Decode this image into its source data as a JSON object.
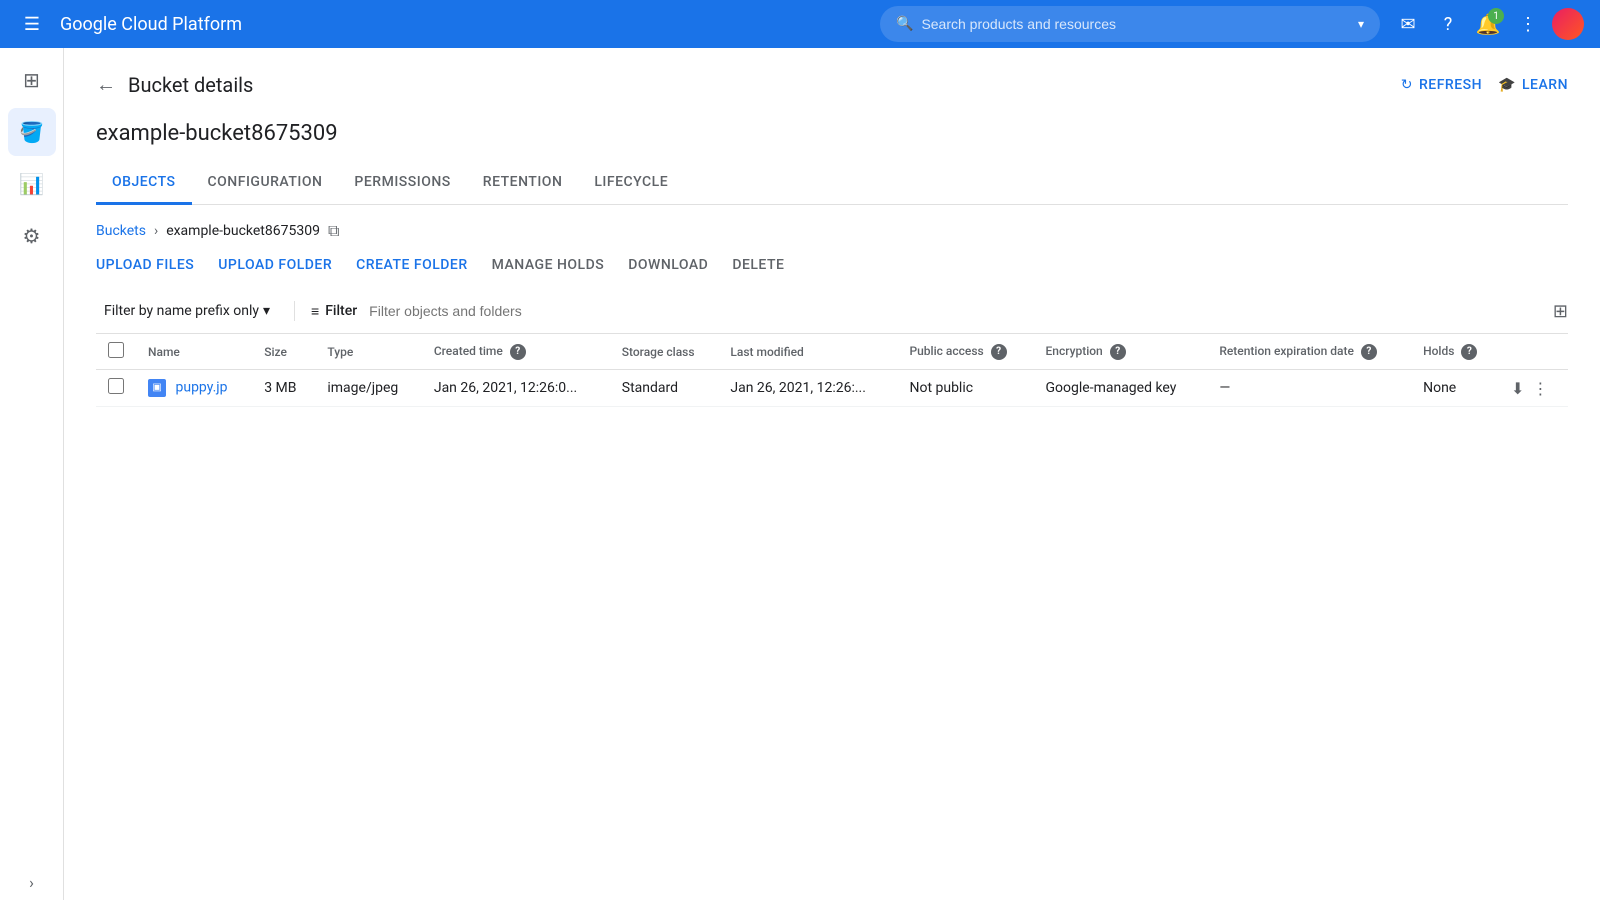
{
  "topnav": {
    "menu_icon": "☰",
    "title": "Google Cloud Platform",
    "search_placeholder": "Search products and resources",
    "dropdown_arrow": "▾",
    "notification_icon": "✉",
    "help_icon": "?",
    "badge_count": "1",
    "more_icon": "⋮"
  },
  "sidebar": {
    "icons": [
      {
        "name": "menu-grid-icon",
        "symbol": "⊞",
        "active": false
      },
      {
        "name": "storage-icon",
        "symbol": "🪣",
        "active": true
      },
      {
        "name": "chart-icon",
        "symbol": "📊",
        "active": false
      },
      {
        "name": "settings-icon",
        "symbol": "⚙",
        "active": false
      }
    ],
    "expand_label": "›"
  },
  "page": {
    "back_icon": "←",
    "title": "Bucket details",
    "refresh_label": "REFRESH",
    "refresh_icon": "↻",
    "learn_label": "LEARN",
    "learn_icon": "🎓",
    "bucket_name": "example-bucket8675309"
  },
  "tabs": [
    {
      "id": "objects",
      "label": "OBJECTS",
      "active": true
    },
    {
      "id": "configuration",
      "label": "CONFIGURATION",
      "active": false
    },
    {
      "id": "permissions",
      "label": "PERMISSIONS",
      "active": false
    },
    {
      "id": "retention",
      "label": "RETENTION",
      "active": false
    },
    {
      "id": "lifecycle",
      "label": "LIFECYCLE",
      "active": false
    }
  ],
  "breadcrumb": {
    "buckets_label": "Buckets",
    "separator": "›",
    "current": "example-bucket8675309",
    "copy_icon": "⧉"
  },
  "actions": [
    {
      "id": "upload-files",
      "label": "UPLOAD FILES",
      "disabled": false
    },
    {
      "id": "upload-folder",
      "label": "UPLOAD FOLDER",
      "disabled": false
    },
    {
      "id": "create-folder",
      "label": "CREATE FOLDER",
      "disabled": false
    },
    {
      "id": "manage-holds",
      "label": "MANAGE HOLDS",
      "disabled": true
    },
    {
      "id": "download",
      "label": "DOWNLOAD",
      "disabled": true
    },
    {
      "id": "delete",
      "label": "DELETE",
      "disabled": true
    }
  ],
  "filter": {
    "prefix_label": "Filter by name prefix only",
    "prefix_arrow": "▾",
    "filter_icon": "≡",
    "filter_label": "Filter",
    "filter_placeholder": "Filter objects and folders",
    "density_icon": "⊞"
  },
  "table": {
    "columns": [
      {
        "id": "name",
        "label": "Name"
      },
      {
        "id": "size",
        "label": "Size"
      },
      {
        "id": "type",
        "label": "Type"
      },
      {
        "id": "created_time",
        "label": "Created time",
        "has_help": true
      },
      {
        "id": "storage_class",
        "label": "Storage class"
      },
      {
        "id": "last_modified",
        "label": "Last modified"
      },
      {
        "id": "public_access",
        "label": "Public access",
        "has_help": true
      },
      {
        "id": "encryption",
        "label": "Encryption",
        "has_help": true
      },
      {
        "id": "retention_expiration",
        "label": "Retention expiration date",
        "has_help": true
      },
      {
        "id": "holds",
        "label": "Holds",
        "has_help": true
      }
    ],
    "rows": [
      {
        "id": "puppy-jpg",
        "name": "puppy.jp",
        "size": "3 MB",
        "type": "image/jpeg",
        "created_time": "Jan 26, 2021, 12:26:0...",
        "storage_class": "Standard",
        "last_modified": "Jan 26, 2021, 12:26:...",
        "public_access": "Not public",
        "encryption": "Google-managed key",
        "retention_expiration": "—",
        "holds": "None"
      }
    ]
  }
}
